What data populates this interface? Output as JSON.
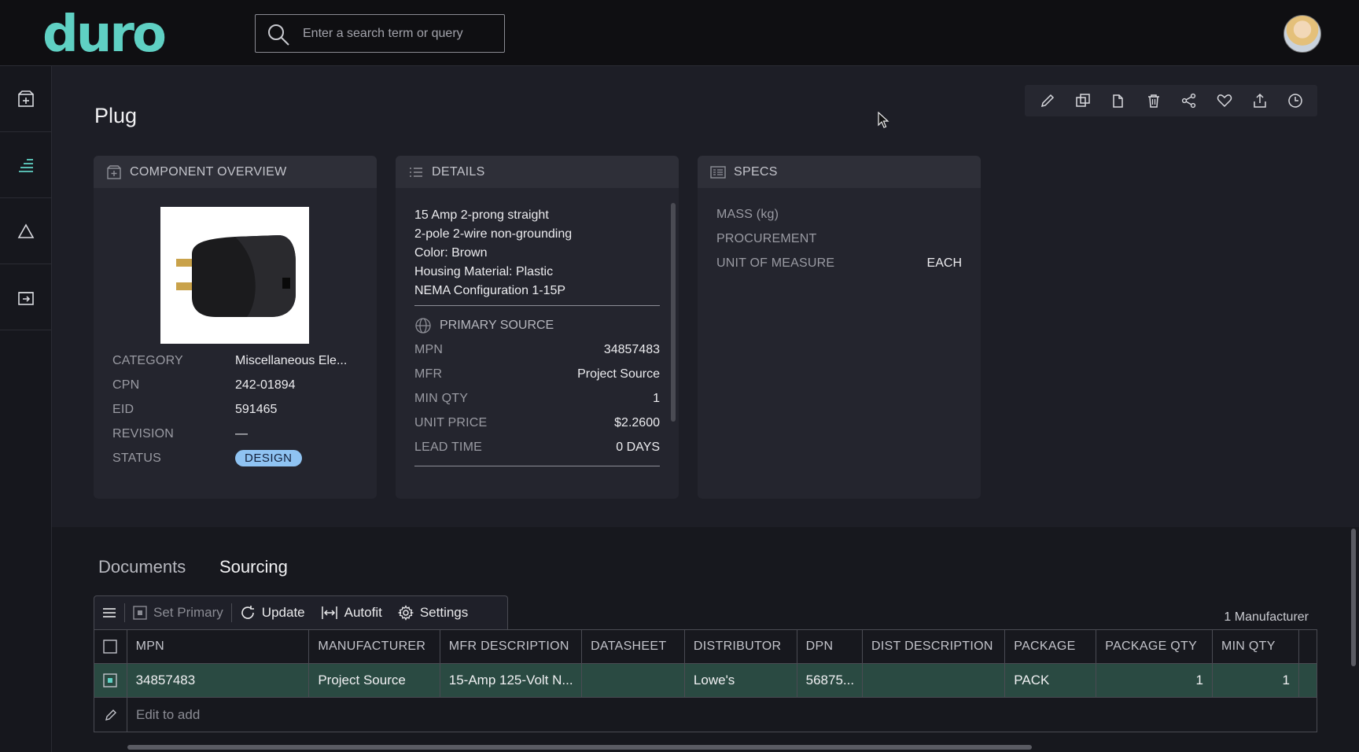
{
  "app": {
    "logo": "duro"
  },
  "search": {
    "placeholder": "Enter a search term or query"
  },
  "page": {
    "title": "Plug"
  },
  "overview": {
    "header": "COMPONENT OVERVIEW",
    "fields": [
      {
        "label": "CATEGORY",
        "value": "Miscellaneous Ele..."
      },
      {
        "label": "CPN",
        "value": "242-01894"
      },
      {
        "label": "EID",
        "value": "591465"
      },
      {
        "label": "REVISION",
        "value": "—"
      },
      {
        "label": "STATUS",
        "value": "DESIGN"
      }
    ]
  },
  "details": {
    "header": "DETAILS",
    "description": [
      "15 Amp 2-prong straight",
      "2-pole 2-wire non-grounding",
      "Color: Brown",
      "Housing Material: Plastic",
      "NEMA Configuration 1-15P"
    ],
    "primary_source_header": "PRIMARY SOURCE",
    "source_fields": [
      {
        "label": "MPN",
        "value": "34857483"
      },
      {
        "label": "MFR",
        "value": "Project Source"
      },
      {
        "label": "MIN QTY",
        "value": "1"
      },
      {
        "label": "UNIT PRICE",
        "value": "$2.2600"
      },
      {
        "label": "LEAD TIME",
        "value": "0 DAYS"
      }
    ]
  },
  "specs": {
    "header": "SPECS",
    "fields": [
      {
        "label": "MASS (kg)",
        "value": ""
      },
      {
        "label": "PROCUREMENT",
        "value": ""
      },
      {
        "label": "UNIT OF MEASURE",
        "value": "EACH"
      }
    ]
  },
  "tabs": {
    "documents": "Documents",
    "sourcing": "Sourcing"
  },
  "grid_toolbar": {
    "set_primary": "Set Primary",
    "update": "Update",
    "autofit": "Autofit",
    "settings": "Settings",
    "manufacturer_count": "1 Manufacturer"
  },
  "grid": {
    "columns": [
      "MPN",
      "MANUFACTURER",
      "MFR DESCRIPTION",
      "DATASHEET",
      "DISTRIBUTOR",
      "DPN",
      "DIST DESCRIPTION",
      "PACKAGE",
      "PACKAGE QTY",
      "MIN QTY"
    ],
    "row": {
      "mpn": "34857483",
      "manufacturer": "Project Source",
      "mfr_description": "15-Amp 125-Volt N...",
      "datasheet": "",
      "distributor": "Lowe's",
      "dpn": "56875...",
      "dist_description": "",
      "package": "PACK",
      "package_qty": "1",
      "min_qty": "1"
    },
    "add_row": "Edit to add"
  },
  "colors": {
    "brand": "#5fd0c3",
    "badge_design": "#8fc3f2",
    "selected_row": "#2a4a42"
  }
}
